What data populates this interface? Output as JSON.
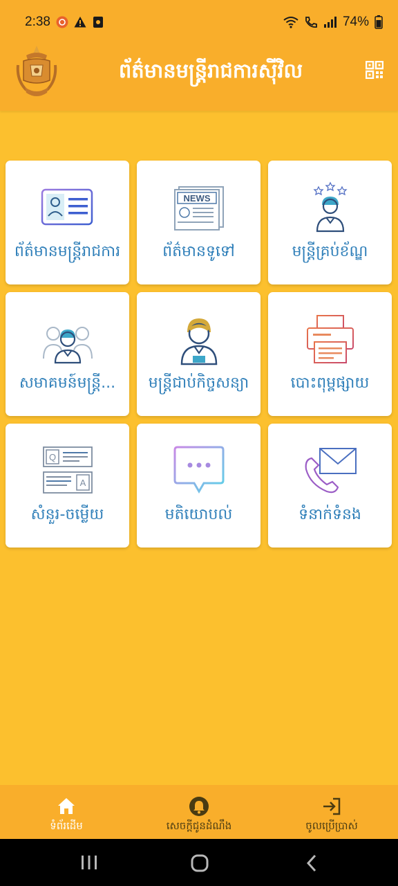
{
  "status_bar": {
    "time": "2:38",
    "battery": "74%",
    "notification_icons": [
      "app-notification-icon",
      "warning-icon",
      "media-icon"
    ],
    "system_icons": [
      "wifi-icon",
      "call-icon",
      "signal-icon",
      "battery-icon"
    ]
  },
  "header": {
    "title": "ព័ត៌មានមន្ត្រីរាជការស៊ីវិល",
    "logo_icon": "emblem-logo",
    "action_icon": "qr-code-icon"
  },
  "tiles": [
    {
      "label": "ព័ត៌មានមន្ត្រីរាជការ",
      "icon": "id-card-icon"
    },
    {
      "label": "ព័ត៌មានទូទៅ",
      "icon": "newspaper-icon"
    },
    {
      "label": "មន្ត្រីគ្រប់ខ័ណ្ឌ",
      "icon": "officer-stars-icon"
    },
    {
      "label": "សមាគមន៍មន្ត្រី...",
      "icon": "group-icon"
    },
    {
      "label": "មន្ត្រីជាប់កិច្ចសន្យា",
      "icon": "contract-officer-icon"
    },
    {
      "label": "បោះពុម្ពផ្សាយ",
      "icon": "printer-icon"
    },
    {
      "label": "សំនួរ-ចម្លើយ",
      "icon": "qa-icon"
    },
    {
      "label": "មតិយោបល់",
      "icon": "chat-bubble-icon"
    },
    {
      "label": "ទំនាក់ទំនង",
      "icon": "contact-phone-mail-icon"
    }
  ],
  "bottom_nav": [
    {
      "label": "ទំព័រដើម",
      "icon": "home-icon",
      "active": true
    },
    {
      "label": "សេចក្ដីជូនដំណឹង",
      "icon": "bell-icon",
      "active": false
    },
    {
      "label": "ចូលប្រើប្រាស់",
      "icon": "login-icon",
      "active": false
    }
  ],
  "colors": {
    "background": "#FCC02E",
    "header": "#F9AE2B",
    "tile_text": "#2F7FB9",
    "white": "#FFFFFF"
  },
  "system_nav": [
    "recents-button",
    "home-button",
    "back-button"
  ]
}
